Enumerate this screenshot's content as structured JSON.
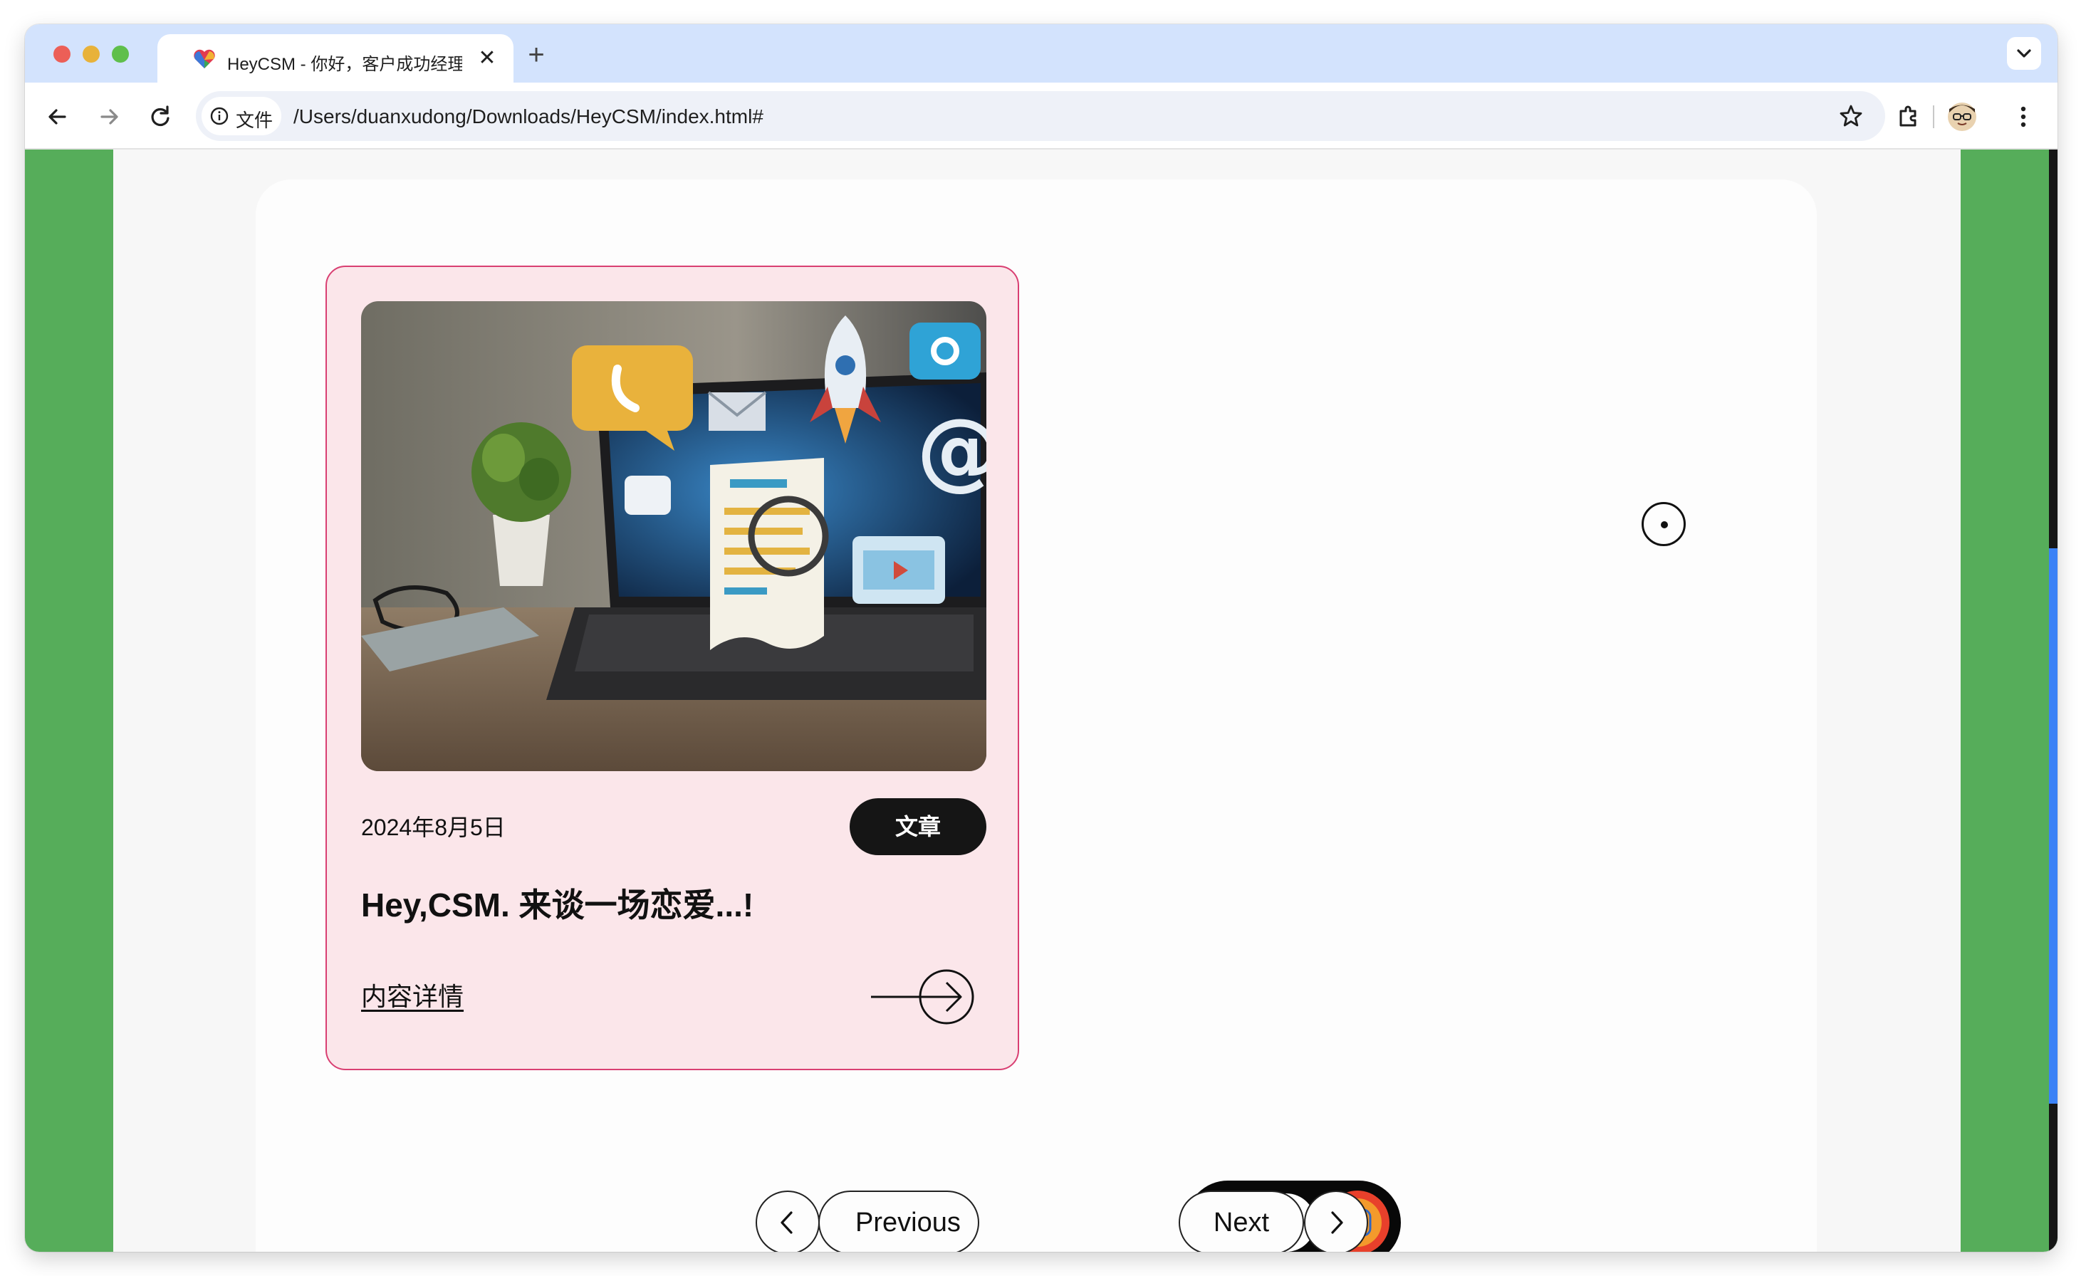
{
  "browser": {
    "tab_title": "HeyCSM - 你好，客户成功经理",
    "tab_close_glyph": "✕",
    "new_tab_glyph": "+",
    "security_chip_label": "文件",
    "url": "/Users/duanxudong/Downloads/HeyCSM/index.html#",
    "icons": [
      "back-arrow-icon",
      "forward-arrow-icon",
      "reload-icon",
      "info-icon",
      "star-icon",
      "extensions-icon",
      "profile-avatar-icon",
      "more-vert-icon",
      "chevron-down-icon"
    ]
  },
  "colors": {
    "tabbar_bg": "#d3e3fd",
    "page_side_green": "#56ad5a",
    "card_bg": "#fbe6ea",
    "card_border": "#d93f72",
    "badge_bg": "#151515",
    "scrollbar_thumb": "#3b82f6"
  },
  "card": {
    "image_description_icon": "laptop-marketing-illustration",
    "date": "2024年8月5日",
    "badge": "文章",
    "title": "Hey,CSM. 来谈一场恋爱...!",
    "link_label": "内容详情"
  },
  "pagination": {
    "previous_label": "Previous",
    "next_label": "Next"
  },
  "dock": {
    "icons": [
      "chat-bubble-icon",
      "grid-apps-icon",
      "camera-app-icon"
    ]
  }
}
